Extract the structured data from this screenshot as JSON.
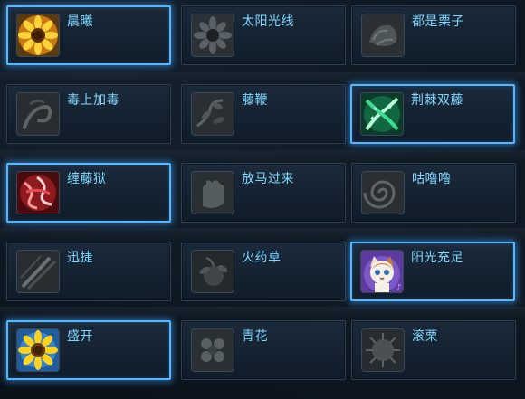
{
  "skills": [
    {
      "name": "晨曦",
      "icon": "sunflower-icon",
      "active": true
    },
    {
      "name": "太阳光线",
      "icon": "sunflower-gray-icon",
      "active": false
    },
    {
      "name": "都是栗子",
      "icon": "chestnut-gray-icon",
      "active": false
    },
    {
      "name": "毒上加毒",
      "icon": "poison-vine-gray-icon",
      "active": false
    },
    {
      "name": "藤鞭",
      "icon": "vine-whip-gray-icon",
      "active": false
    },
    {
      "name": "荆棘双藤",
      "icon": "thorn-vines-icon",
      "active": true
    },
    {
      "name": "缠藤狱",
      "icon": "tangle-vine-icon",
      "active": true
    },
    {
      "name": "放马过来",
      "icon": "hand-gray-icon",
      "active": false
    },
    {
      "name": "咕噜噜",
      "icon": "swirl-gray-icon",
      "active": false
    },
    {
      "name": "迅捷",
      "icon": "slash-gray-icon",
      "active": false
    },
    {
      "name": "火药草",
      "icon": "bomb-plant-gray-icon",
      "active": false
    },
    {
      "name": "阳光充足",
      "icon": "cat-pet-icon",
      "active": true
    },
    {
      "name": "盛开",
      "icon": "sunflower-bloom-icon",
      "active": true
    },
    {
      "name": "青花",
      "icon": "flower-gray-icon",
      "active": false
    },
    {
      "name": "滚栗",
      "icon": "spiky-chestnut-gray-icon",
      "active": false
    }
  ]
}
